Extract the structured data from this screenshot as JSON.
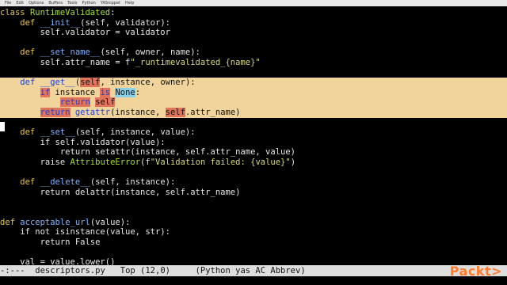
{
  "menubar": [
    "File",
    "Edit",
    "Options",
    "Buffers",
    "Tools",
    "Python",
    "YASnippet",
    "Help"
  ],
  "code": {
    "l1_kw": "class",
    "l1_name": "RuntimeValidated",
    "l1_rest": ":",
    "l2_kw": "    def",
    "l2_fn": "__init__",
    "l2_rest": "(self, validator):",
    "l3": "        self.validator = validator",
    "l5_kw": "    def",
    "l5_fn": "__set_name__",
    "l5_rest": "(self, owner, name):",
    "l6_a": "        self.attr_name = f",
    "l6_str": "\"_runtimevalidated_{name}\"",
    "l8_pad": "    ",
    "l8_kw": "def",
    "l8_sp": " ",
    "l8_fn": "__get__",
    "l8_p": "(",
    "l8_self": "self",
    "l8_rest": ", instance, owner):",
    "l9_pad": "        ",
    "l9_if": "if",
    "l9_mid": " instance ",
    "l9_is": "is",
    "l9_sp": " ",
    "l9_none": "None",
    "l9_end": ":",
    "l10_pad": "            ",
    "l10_kw": "return",
    "l10_sp": " ",
    "l10_self": "self",
    "l11_pad": "        ",
    "l11_kw": "return",
    "l11_sp": " ",
    "l11_fn": "getattr",
    "l11_mid": "(instance, ",
    "l11_self": "self",
    "l11_end": ".attr_name)",
    "l13_kw": "    def",
    "l13_fn": "__set__",
    "l13_rest": "(self, instance, value):",
    "l14": "        if self.validator(value):",
    "l15": "            return setattr(instance, self.attr_name, value)",
    "l16_a": "        raise ",
    "l16_cls": "AttributeError",
    "l16_b": "(f",
    "l16_str": "\"Validation failed: {value}\"",
    "l16_c": ")",
    "l18_kw": "    def",
    "l18_fn": "__delete__",
    "l18_rest": "(self, instance):",
    "l19": "        return delattr(instance, self.attr_name)",
    "l22_kw": "def",
    "l22_fn": "acceptable_url",
    "l22_rest": "(value):",
    "l23": "    if not isinstance(value, str):",
    "l24": "        return False",
    "l26": "    val = value.lower()"
  },
  "modeline": {
    "status": "-:---  ",
    "buffer": "descriptors.py",
    "position": "   Top (12,0)     ",
    "modes": "(Python yas AC Abbrev)"
  },
  "logo": "Packt>"
}
